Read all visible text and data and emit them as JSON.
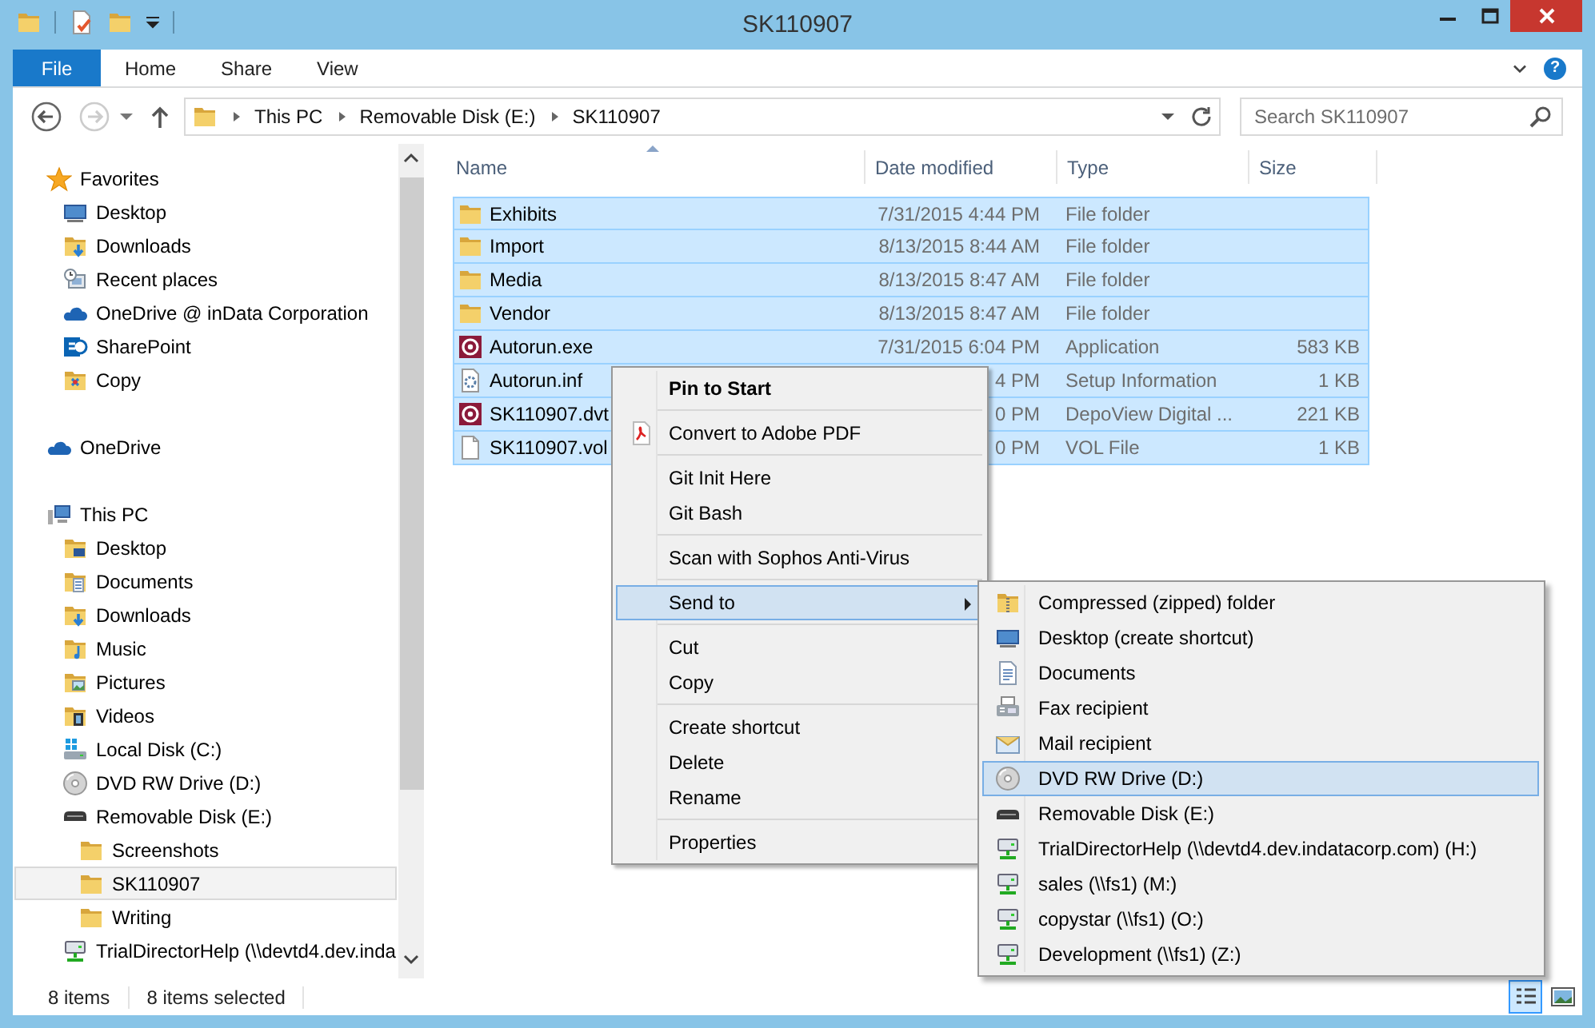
{
  "window": {
    "title": "SK110907"
  },
  "ribbon": {
    "tabs": [
      {
        "label": "File",
        "kind": "file",
        "selected": false
      },
      {
        "label": "Home",
        "kind": "tab",
        "selected": false
      },
      {
        "label": "Share",
        "kind": "tab",
        "selected": false
      },
      {
        "label": "View",
        "kind": "tab",
        "selected": false
      }
    ],
    "help": "?"
  },
  "address": {
    "crumbs": [
      "This PC",
      "Removable Disk (E:)",
      "SK110907"
    ]
  },
  "search": {
    "placeholder": "Search SK110907"
  },
  "nav": [
    {
      "label": "Favorites",
      "kind": "star",
      "selected": false,
      "children": [
        {
          "label": "Desktop",
          "kind": "desktop",
          "selected": false
        },
        {
          "label": "Downloads",
          "kind": "downloads",
          "selected": false
        },
        {
          "label": "Recent places",
          "kind": "recent",
          "selected": false
        },
        {
          "label": "OneDrive @ inData Corporation",
          "kind": "cloud",
          "selected": false
        },
        {
          "label": "SharePoint",
          "kind": "site",
          "selected": false
        },
        {
          "label": "Copy",
          "kind": "copy",
          "selected": false
        }
      ]
    },
    {
      "label": "OneDrive",
      "kind": "cloud",
      "selected": false
    },
    {
      "label": "This PC",
      "kind": "pc",
      "selected": false,
      "children": [
        {
          "label": "Desktop",
          "kind": "desktopfolder",
          "selected": false
        },
        {
          "label": "Documents",
          "kind": "documents",
          "selected": false
        },
        {
          "label": "Downloads",
          "kind": "downloads",
          "selected": false
        },
        {
          "label": "Music",
          "kind": "music",
          "selected": false
        },
        {
          "label": "Pictures",
          "kind": "pictures",
          "selected": false
        },
        {
          "label": "Videos",
          "kind": "videos",
          "selected": false
        },
        {
          "label": "Local Disk (C:)",
          "kind": "localdisk",
          "selected": false
        },
        {
          "label": "DVD RW Drive (D:)",
          "kind": "dvd",
          "selected": false
        },
        {
          "label": "Removable Disk (E:)",
          "kind": "removable",
          "selected": false,
          "children": [
            {
              "label": "Screenshots",
              "kind": "folder",
              "selected": false
            },
            {
              "label": "SK110907",
              "kind": "folder",
              "selected": true
            },
            {
              "label": "Writing",
              "kind": "folder",
              "selected": false
            }
          ]
        },
        {
          "label": "TrialDirectorHelp (\\\\devtd4.dev.inda",
          "kind": "netdrive",
          "selected": false
        }
      ]
    }
  ],
  "file_list": {
    "columns": [
      {
        "label": "Name",
        "sorted": true
      },
      {
        "label": "Date modified",
        "sorted": false
      },
      {
        "label": "Type",
        "sorted": false
      },
      {
        "label": "Size",
        "sorted": false
      }
    ],
    "rows": [
      {
        "name": "Exhibits",
        "kind": "folder",
        "date": "7/31/2015 4:44 PM",
        "type": "File folder",
        "size": "",
        "selected": true
      },
      {
        "name": "Import",
        "kind": "folder",
        "date": "8/13/2015 8:44 AM",
        "type": "File folder",
        "size": "",
        "selected": true
      },
      {
        "name": "Media",
        "kind": "folder",
        "date": "8/13/2015 8:47 AM",
        "type": "File folder",
        "size": "",
        "selected": true
      },
      {
        "name": "Vendor",
        "kind": "folder",
        "date": "8/13/2015 8:47 AM",
        "type": "File folder",
        "size": "",
        "selected": true
      },
      {
        "name": "Autorun.exe",
        "kind": "app",
        "date": "7/31/2015 6:04 PM",
        "type": "Application",
        "size": "583 KB",
        "selected": true
      },
      {
        "name": "Autorun.inf",
        "kind": "settings",
        "date": "4 PM",
        "type": "Setup Information",
        "size": "1 KB",
        "selected": true
      },
      {
        "name": "SK110907.dvt",
        "kind": "app",
        "date": "0 PM",
        "type": "DepoView Digital ...",
        "size": "221 KB",
        "selected": true
      },
      {
        "name": "SK110907.vol",
        "kind": "file",
        "date": "0 PM",
        "type": "VOL File",
        "size": "1 KB",
        "selected": true
      }
    ]
  },
  "context_menu": {
    "groups": [
      [
        {
          "label": "Pin to Start",
          "default": true,
          "selected": false
        }
      ],
      [
        {
          "label": "Convert to Adobe PDF",
          "kind": "pdf",
          "default": false,
          "selected": false
        }
      ],
      [
        {
          "label": "Git Init Here",
          "default": false,
          "selected": false
        },
        {
          "label": "Git Bash",
          "default": false,
          "selected": false
        }
      ],
      [
        {
          "label": "Scan with Sophos Anti-Virus",
          "default": false,
          "selected": false
        }
      ],
      [
        {
          "label": "Send to",
          "default": false,
          "selected": true,
          "submenu": [
            {
              "label": "Compressed (zipped) folder",
              "kind": "zip",
              "selected": false
            },
            {
              "label": "Desktop (create shortcut)",
              "kind": "desktop",
              "selected": false
            },
            {
              "label": "Documents",
              "kind": "doc",
              "selected": false
            },
            {
              "label": "Fax recipient",
              "kind": "fax",
              "selected": false
            },
            {
              "label": "Mail recipient",
              "kind": "mail",
              "selected": false
            },
            {
              "label": "DVD RW Drive (D:)",
              "kind": "dvd",
              "selected": true
            },
            {
              "label": "Removable Disk (E:)",
              "kind": "removable",
              "selected": false
            },
            {
              "label": "TrialDirectorHelp (\\\\devtd4.dev.indatacorp.com) (H:)",
              "kind": "netdrive",
              "selected": false
            },
            {
              "label": "sales (\\\\fs1) (M:)",
              "kind": "netdrive",
              "selected": false
            },
            {
              "label": "copystar (\\\\fs1) (O:)",
              "kind": "netdrive",
              "selected": false
            },
            {
              "label": "Development (\\\\fs1) (Z:)",
              "kind": "netdrive",
              "selected": false
            }
          ]
        }
      ],
      [
        {
          "label": "Cut",
          "default": false,
          "selected": false
        },
        {
          "label": "Copy",
          "default": false,
          "selected": false
        }
      ],
      [
        {
          "label": "Create shortcut",
          "default": false,
          "selected": false
        },
        {
          "label": "Delete",
          "default": false,
          "selected": false
        },
        {
          "label": "Rename",
          "default": false,
          "selected": false
        }
      ],
      [
        {
          "label": "Properties",
          "default": false,
          "selected": false
        }
      ]
    ]
  },
  "status_bar": {
    "item_count": "8 items",
    "selection": "8 items selected",
    "views": [
      {
        "kind": "details",
        "selected": true
      },
      {
        "kind": "large_icons",
        "selected": false
      }
    ]
  }
}
